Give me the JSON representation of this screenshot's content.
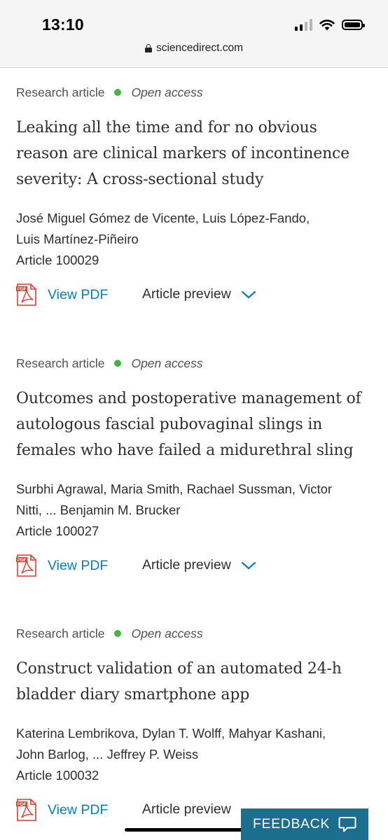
{
  "status_bar": {
    "time": "13:10"
  },
  "url_bar": {
    "domain": "sciencedirect.com"
  },
  "articles": [
    {
      "type": "Research article",
      "access": "Open access",
      "title_lines": [
        "Leaking all the time and for no obvious",
        "reason are clinical markers of incontinence",
        "severity: A cross-sectional study"
      ],
      "author_lines": [
        "José Miguel Gómez de Vicente, Luis López-Fando,",
        "Luis Martínez-Piñeiro"
      ],
      "article_number": "Article 100029",
      "view_pdf": "View PDF",
      "preview": "Article preview"
    },
    {
      "type": "Research article",
      "access": "Open access",
      "title_lines": [
        "Outcomes and postoperative management of",
        "autologous fascial pubovaginal slings in",
        "females who have failed a midurethral sling"
      ],
      "author_lines": [
        "Surbhi Agrawal, Maria Smith, Rachael Sussman, Victor",
        "Nitti, ... Benjamin M. Brucker"
      ],
      "article_number": "Article 100027",
      "view_pdf": "View PDF",
      "preview": "Article preview"
    },
    {
      "type": "Research article",
      "access": "Open access",
      "title_lines": [
        "Construct validation of an automated 24-h",
        "bladder diary smartphone app"
      ],
      "author_lines": [
        "Katerina Lembrikova, Dylan T. Wolff, Mahyar Kashani,",
        "John Barlog, ... Jeffrey P. Weiss"
      ],
      "article_number": "Article 100032",
      "view_pdf": "View PDF",
      "preview": "Article preview"
    }
  ],
  "feedback": {
    "label": "FEEDBACK"
  },
  "colors": {
    "open_access_dot": "#44b449",
    "link_blue": "#0c7dbb",
    "pdf_red": "#e9372f",
    "feedback_bg": "#1c6e8f"
  },
  "icons": {
    "lock": "lock-icon",
    "pdf": "pdf-icon",
    "chevron": "chevron-down-icon",
    "chat": "chat-icon"
  }
}
